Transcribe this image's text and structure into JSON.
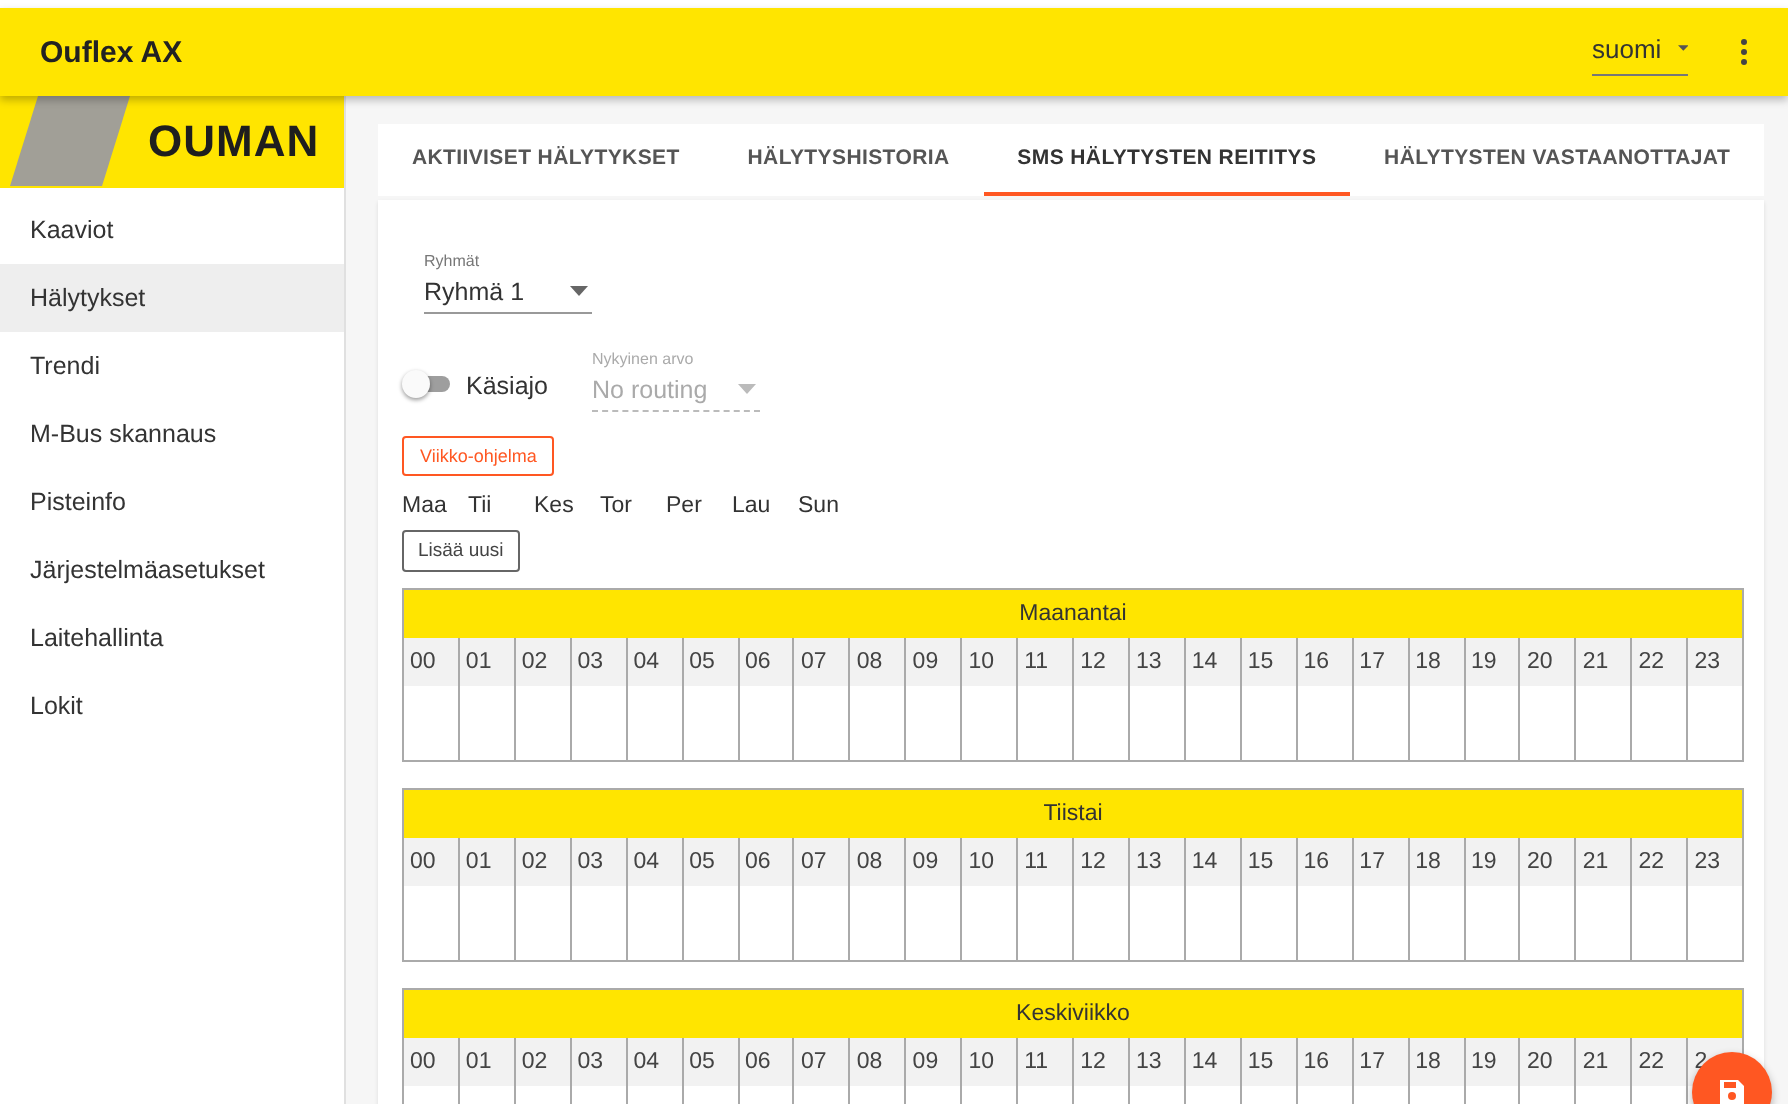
{
  "app_bar": {
    "title": "Ouflex AX",
    "language": "suomi"
  },
  "logo": {
    "text": "OUMAN"
  },
  "sidebar": {
    "items": [
      {
        "label": "Kaaviot",
        "selected": false
      },
      {
        "label": "Hälytykset",
        "selected": true
      },
      {
        "label": "Trendi",
        "selected": false
      },
      {
        "label": "M-Bus skannaus",
        "selected": false
      },
      {
        "label": "Pisteinfo",
        "selected": false
      },
      {
        "label": "Järjestelmäasetukset",
        "selected": false
      },
      {
        "label": "Laitehallinta",
        "selected": false
      },
      {
        "label": "Lokit",
        "selected": false
      }
    ]
  },
  "tabs": [
    {
      "label": "AKTIIVISET HÄLYTYKSET",
      "selected": false
    },
    {
      "label": "HÄLYTYSHISTORIA",
      "selected": false
    },
    {
      "label": "SMS HÄLYTYSTEN REITITYS",
      "selected": true
    },
    {
      "label": "HÄLYTYSTEN VASTAANOTTAJAT",
      "selected": false
    }
  ],
  "groups_select": {
    "label": "Ryhmät",
    "value": "Ryhmä 1"
  },
  "manual_switch": {
    "label": "Käsiajo",
    "on": false
  },
  "current_value": {
    "label": "Nykyinen arvo",
    "value": "No routing",
    "disabled": true
  },
  "week_program_button": "Viikko-ohjelma",
  "weekdays": [
    "Maa",
    "Tii",
    "Kes",
    "Tor",
    "Per",
    "Lau",
    "Sun"
  ],
  "add_button": "Lisää uusi",
  "days": [
    {
      "name": "Maanantai",
      "hours": [
        "00",
        "01",
        "02",
        "03",
        "04",
        "05",
        "06",
        "07",
        "08",
        "09",
        "10",
        "11",
        "12",
        "13",
        "14",
        "15",
        "16",
        "17",
        "18",
        "19",
        "20",
        "21",
        "22",
        "23"
      ]
    },
    {
      "name": "Tiistai",
      "hours": [
        "00",
        "01",
        "02",
        "03",
        "04",
        "05",
        "06",
        "07",
        "08",
        "09",
        "10",
        "11",
        "12",
        "13",
        "14",
        "15",
        "16",
        "17",
        "18",
        "19",
        "20",
        "21",
        "22",
        "23"
      ]
    },
    {
      "name": "Keskiviikko",
      "hours": [
        "00",
        "01",
        "02",
        "03",
        "04",
        "05",
        "06",
        "07",
        "08",
        "09",
        "10",
        "11",
        "12",
        "13",
        "14",
        "15",
        "16",
        "17",
        "18",
        "19",
        "20",
        "21",
        "22",
        "2"
      ]
    }
  ]
}
